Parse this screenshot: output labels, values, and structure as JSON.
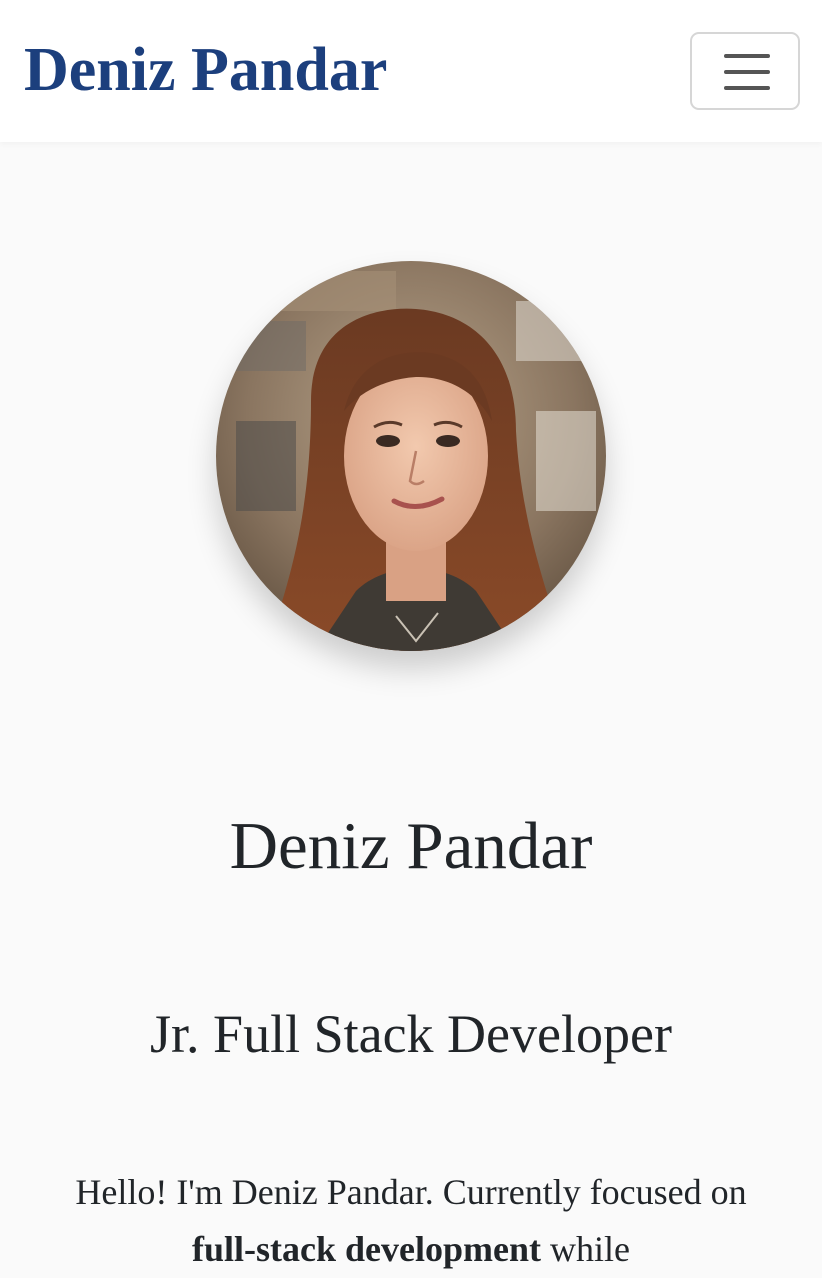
{
  "navbar": {
    "brand": "Deniz Pandar",
    "toggle_icon": "hamburger-menu-icon"
  },
  "hero": {
    "avatar_alt": "Deniz Pandar",
    "name": "Deniz Pandar",
    "role": "Jr. Full Stack Developer",
    "intro_part1": "Hello! I'm Deniz Pandar. Currently focused on ",
    "intro_bold": "full-stack development",
    "intro_part2": " while"
  },
  "colors": {
    "brand": "#1c3f7d",
    "page_bg": "#fafafa",
    "navbar_bg": "#ffffff",
    "text": "#212529"
  }
}
